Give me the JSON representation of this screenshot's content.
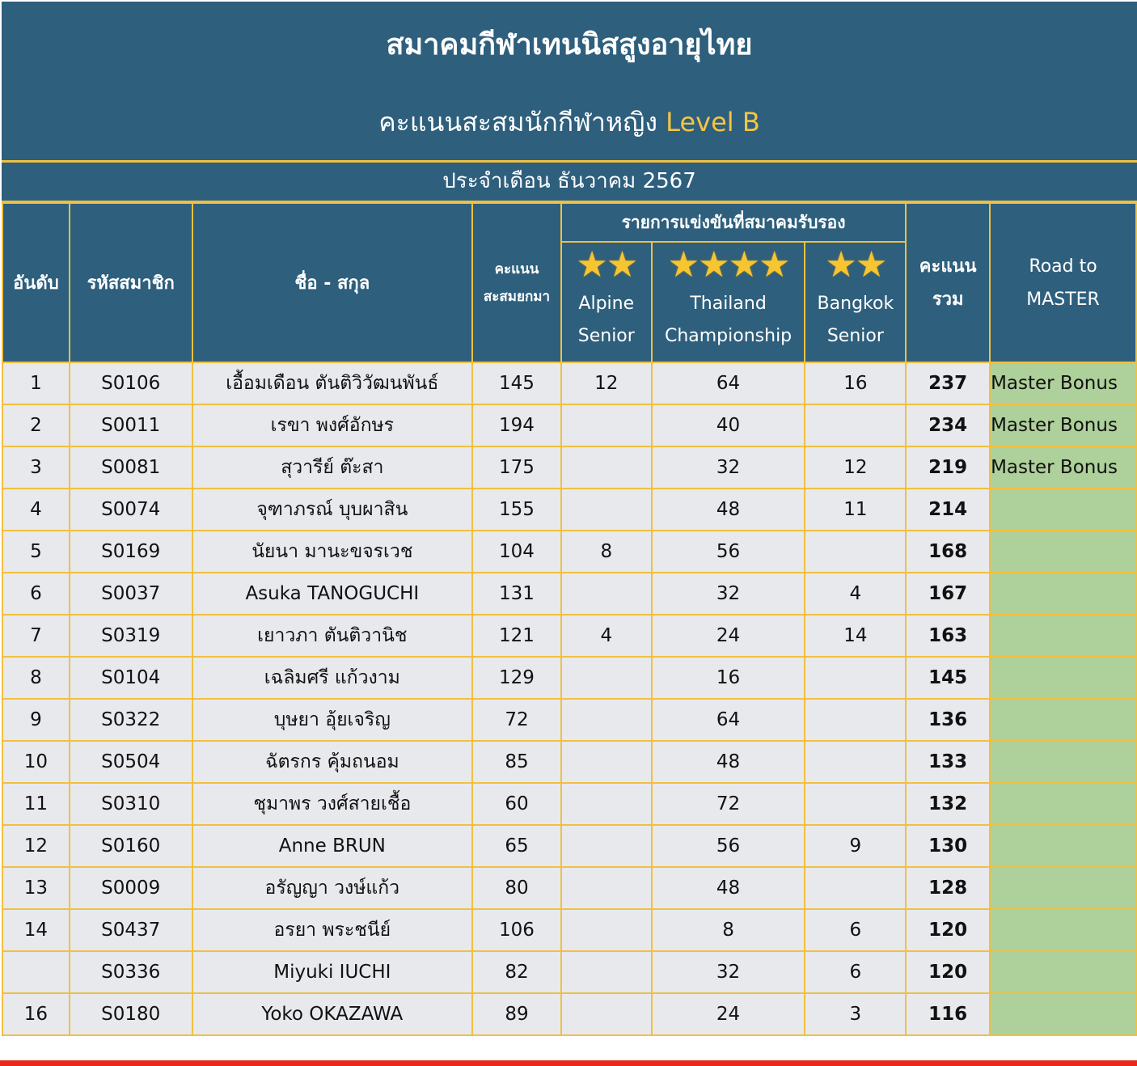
{
  "header": {
    "title": "สมาคมกีฬาเทนนิสสูงอายุไทย",
    "subtitle_prefix": "คะแนนสะสมนักกีฬาหญิง",
    "subtitle_level": "Level B",
    "period": "ประจำเดือน ธันวาคม 2567"
  },
  "columns": {
    "rank": "อันดับ",
    "member_id": "รหัสสมาชิก",
    "name": "ชื่อ - สกุล",
    "carried_line1": "คะแนน",
    "carried_line2": "สะสมยกมา",
    "group_title": "รายการแข่งขันที่สมาคมรับรอง",
    "comp1_stars": "★★",
    "comp1_line1": "Alpine",
    "comp1_line2": "Senior",
    "comp2_stars": "★★★★",
    "comp2_line1": "Thailand",
    "comp2_line2": "Championship",
    "comp3_stars": "★★",
    "comp3_line1": "Bangkok",
    "comp3_line2": "Senior",
    "total_line1": "คะแนน",
    "total_line2": "รวม",
    "road_line1": "Road to",
    "road_line2": "MASTER"
  },
  "rows": [
    {
      "rank": "1",
      "id": "S0106",
      "name": "เอื้อมเดือน  ตันติวิวัฒนพันธ์",
      "carried": "145",
      "c1": "12",
      "c2": "64",
      "c3": "16",
      "total": "237",
      "road": "Master Bonus"
    },
    {
      "rank": "2",
      "id": "S0011",
      "name": "เรขา  พงศ์อักษร",
      "carried": "194",
      "c1": "",
      "c2": "40",
      "c3": "",
      "total": "234",
      "road": "Master Bonus"
    },
    {
      "rank": "3",
      "id": "S0081",
      "name": "สุวารีย์   ต๊ะสา",
      "carried": "175",
      "c1": "",
      "c2": "32",
      "c3": "12",
      "total": "219",
      "road": "Master Bonus"
    },
    {
      "rank": "4",
      "id": "S0074",
      "name": "จุฑาภรณ์  บุบผาสิน",
      "carried": "155",
      "c1": "",
      "c2": "48",
      "c3": "11",
      "total": "214",
      "road": ""
    },
    {
      "rank": "5",
      "id": "S0169",
      "name": "นัยนา  มานะขจรเวช",
      "carried": "104",
      "c1": "8",
      "c2": "56",
      "c3": "",
      "total": "168",
      "road": ""
    },
    {
      "rank": "6",
      "id": "S0037",
      "name": "Asuka  TANOGUCHI",
      "carried": "131",
      "c1": "",
      "c2": "32",
      "c3": "4",
      "total": "167",
      "road": ""
    },
    {
      "rank": "7",
      "id": "S0319",
      "name": "เยาวภา   ตันติวานิช",
      "carried": "121",
      "c1": "4",
      "c2": "24",
      "c3": "14",
      "total": "163",
      "road": ""
    },
    {
      "rank": "8",
      "id": "S0104",
      "name": "เฉลิมศรี  แก้วงาม",
      "carried": "129",
      "c1": "",
      "c2": "16",
      "c3": "",
      "total": "145",
      "road": ""
    },
    {
      "rank": "9",
      "id": "S0322",
      "name": "บุษยา  อุ้ยเจริญ",
      "carried": "72",
      "c1": "",
      "c2": "64",
      "c3": "",
      "total": "136",
      "road": ""
    },
    {
      "rank": "10",
      "id": "S0504",
      "name": "ฉัตรกร  คุ้มถนอม",
      "carried": "85",
      "c1": "",
      "c2": "48",
      "c3": "",
      "total": "133",
      "road": ""
    },
    {
      "rank": "11",
      "id": "S0310",
      "name": "ชุมาพร  วงศ์สายเชื้อ",
      "carried": "60",
      "c1": "",
      "c2": "72",
      "c3": "",
      "total": "132",
      "road": ""
    },
    {
      "rank": "12",
      "id": "S0160",
      "name": "Anne  BRUN",
      "carried": "65",
      "c1": "",
      "c2": "56",
      "c3": "9",
      "total": "130",
      "road": ""
    },
    {
      "rank": "13",
      "id": "S0009",
      "name": "อรัญญา  วงษ์แก้ว",
      "carried": "80",
      "c1": "",
      "c2": "48",
      "c3": "",
      "total": "128",
      "road": ""
    },
    {
      "rank": "14",
      "id": "S0437",
      "name": "อรยา  พระชนีย์",
      "carried": "106",
      "c1": "",
      "c2": "8",
      "c3": "6",
      "total": "120",
      "road": ""
    },
    {
      "rank": "",
      "id": "S0336",
      "name": "Miyuki  IUCHI",
      "carried": "82",
      "c1": "",
      "c2": "32",
      "c3": "6",
      "total": "120",
      "road": ""
    },
    {
      "rank": "16",
      "id": "S0180",
      "name": "Yoko  OKAZAWA",
      "carried": "89",
      "c1": "",
      "c2": "24",
      "c3": "3",
      "total": "116",
      "road": ""
    }
  ],
  "colors": {
    "header_bg": "#2e5f7d",
    "grid_line": "#f0c040",
    "cell_bg": "#e8e9ed",
    "road_bg": "#aed09a",
    "level_text": "#f4c542",
    "bottom_bar": "#e8281a"
  }
}
